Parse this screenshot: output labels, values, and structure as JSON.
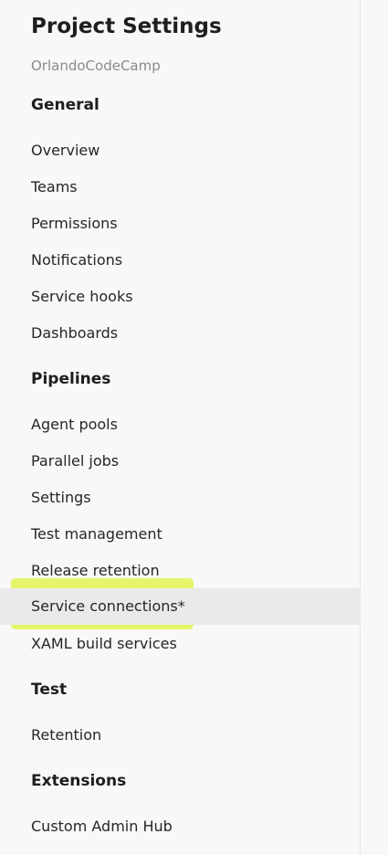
{
  "sidebar": {
    "title": "Project Settings",
    "project_name": "OrlandoCodeCamp",
    "sections": [
      {
        "heading": "General",
        "items": [
          {
            "label": "Overview"
          },
          {
            "label": "Teams"
          },
          {
            "label": "Permissions"
          },
          {
            "label": "Notifications"
          },
          {
            "label": "Service hooks"
          },
          {
            "label": "Dashboards"
          }
        ]
      },
      {
        "heading": "Pipelines",
        "items": [
          {
            "label": "Agent pools"
          },
          {
            "label": "Parallel jobs"
          },
          {
            "label": "Settings"
          },
          {
            "label": "Test management"
          },
          {
            "label": "Release retention"
          },
          {
            "label": "Service connections*"
          },
          {
            "label": "XAML build services"
          }
        ]
      },
      {
        "heading": "Test",
        "items": [
          {
            "label": "Retention"
          }
        ]
      },
      {
        "heading": "Extensions",
        "items": [
          {
            "label": "Custom Admin Hub"
          }
        ]
      }
    ]
  },
  "colors": {
    "background": "#f8f8f8",
    "selected_row": "#eaeaea",
    "highlight_marker": "#e3f35a",
    "text_primary": "#1e1e1e",
    "text_secondary": "#8a8a8a"
  }
}
